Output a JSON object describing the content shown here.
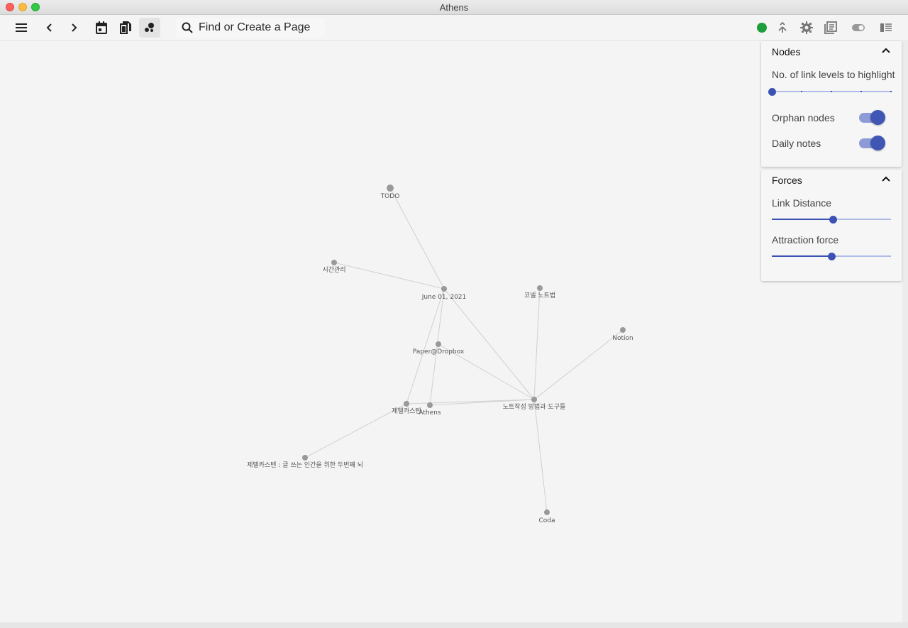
{
  "window": {
    "title": "Athens"
  },
  "toolbar": {
    "menu_icon": "hamburger-menu-icon",
    "back_icon": "chevron-left-icon",
    "forward_icon": "chevron-right-icon",
    "daily_notes_icon": "calendar-icon",
    "all_pages_icon": "pages-icon",
    "graph_icon": "graph-icon",
    "search": {
      "placeholder": "Find or Create a Page",
      "icon": "search-icon"
    },
    "right_icons": [
      "sync-status-icon",
      "merge-icon",
      "gear-icon",
      "library-icon",
      "theme-toggle-icon",
      "right-sidebar-icon"
    ],
    "status_color": "#1e9e3a"
  },
  "graph": {
    "nodes": [
      {
        "id": "todo",
        "label": "TODO"
      },
      {
        "id": "sigan",
        "label": "시간관리"
      },
      {
        "id": "june",
        "label": "June 01, 2021"
      },
      {
        "id": "kornell",
        "label": "코넬 노트법"
      },
      {
        "id": "notion",
        "label": "Notion"
      },
      {
        "id": "paper",
        "label": "Paper@Dropbox"
      },
      {
        "id": "zettel",
        "label": "제텔카스텐"
      },
      {
        "id": "athens",
        "label": "Athens"
      },
      {
        "id": "notetool",
        "label": "노트작성 방법과 도구들"
      },
      {
        "id": "zettelbook",
        "label": "제텔카스텐 : 글 쓰는 인간을 위한 두번째 뇌"
      },
      {
        "id": "coda",
        "label": "Coda"
      }
    ],
    "edges": [
      [
        "todo",
        "june"
      ],
      [
        "sigan",
        "june"
      ],
      [
        "june",
        "zettel"
      ],
      [
        "june",
        "athens"
      ],
      [
        "june",
        "notetool"
      ],
      [
        "paper",
        "notetool"
      ],
      [
        "kornell",
        "notetool"
      ],
      [
        "notion",
        "notetool"
      ],
      [
        "zettel",
        "notetool"
      ],
      [
        "athens",
        "notetool"
      ],
      [
        "zettel",
        "zettelbook"
      ],
      [
        "notetool",
        "coda"
      ]
    ],
    "node_color": "#999999",
    "edge_color": "#d0d0d0"
  },
  "nodes_panel": {
    "title": "Nodes",
    "link_levels_label": "No. of link levels to highlight",
    "link_levels_value": 0,
    "link_levels_max": 4,
    "orphan_label": "Orphan nodes",
    "orphan_on": true,
    "daily_label": "Daily notes",
    "daily_on": true
  },
  "forces_panel": {
    "title": "Forces",
    "link_distance_label": "Link Distance",
    "link_distance_fraction": 0.51,
    "attraction_label": "Attraction force",
    "attraction_fraction": 0.5
  },
  "colors": {
    "accent": "#3b52b4",
    "accent_light": "#aebce6"
  }
}
